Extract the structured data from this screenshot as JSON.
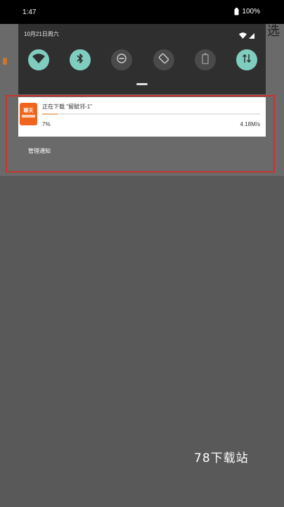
{
  "status_bar": {
    "time": "1:47",
    "battery": "100%"
  },
  "quick_settings": {
    "date": "10月21日周六",
    "tiles": [
      {
        "name": "wifi",
        "on": true
      },
      {
        "name": "bluetooth",
        "on": true
      },
      {
        "name": "do-not-disturb",
        "on": false
      },
      {
        "name": "auto-rotate",
        "on": false
      },
      {
        "name": "battery-saver",
        "on": false
      },
      {
        "name": "mobile-data",
        "on": true
      }
    ]
  },
  "notification": {
    "title": "正在下载 \"留赋邻-1\"",
    "progress_percent": 7,
    "percent_label": "7%",
    "speed": "4.18M/s"
  },
  "manage_label": "管理通知",
  "background_glyph": "选",
  "watermark": "78下载站",
  "colors": {
    "accent_tile": "#7fcdbf",
    "app_icon": "#f0641e",
    "highlight": "#c8342f"
  }
}
